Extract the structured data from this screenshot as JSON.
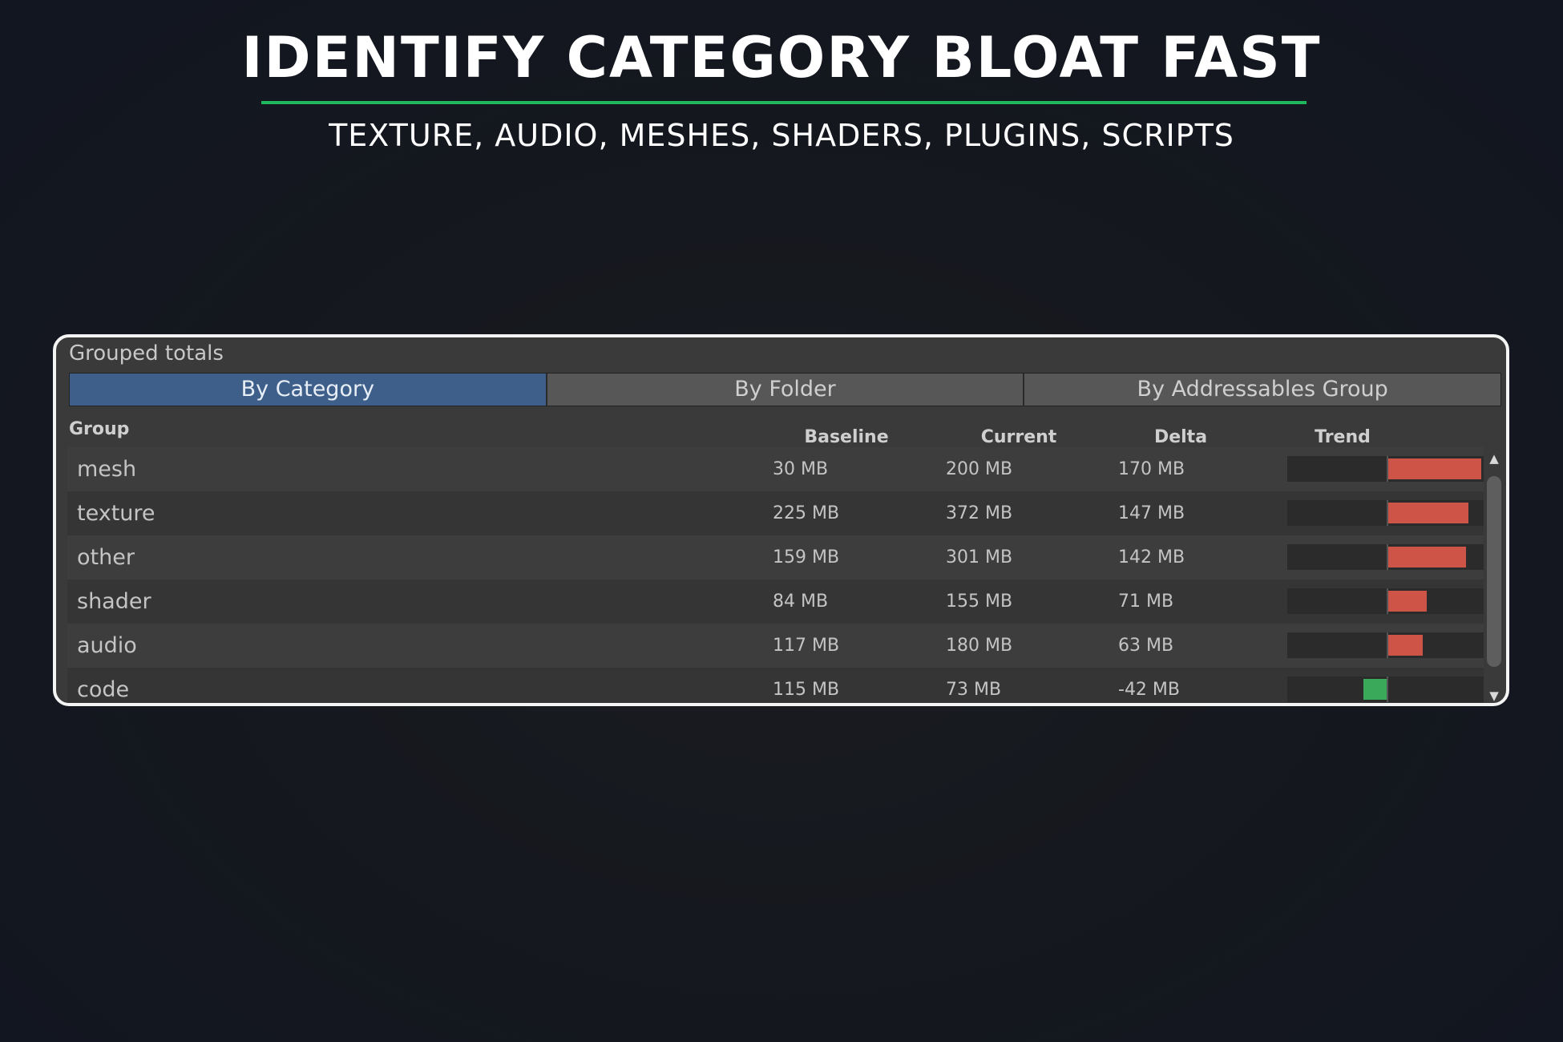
{
  "hero": {
    "title": "IDENTIFY CATEGORY BLOAT FAST",
    "subtitle": "TEXTURE, AUDIO, MESHES, SHADERS, PLUGINS, SCRIPTS"
  },
  "panel": {
    "title": "Grouped totals",
    "tabs": [
      {
        "label": "By Category",
        "active": true
      },
      {
        "label": "By Folder",
        "active": false
      },
      {
        "label": "By Addressables Group",
        "active": false
      }
    ],
    "columns": {
      "group": "Group",
      "baseline": "Baseline",
      "current": "Current",
      "delta": "Delta",
      "trend": "Trend"
    },
    "rows": [
      {
        "group": "mesh",
        "baseline": "30 MB",
        "current": "200 MB",
        "delta": "170 MB",
        "delta_mb": 170
      },
      {
        "group": "texture",
        "baseline": "225 MB",
        "current": "372 MB",
        "delta": "147 MB",
        "delta_mb": 147
      },
      {
        "group": "other",
        "baseline": "159 MB",
        "current": "301 MB",
        "delta": "142 MB",
        "delta_mb": 142
      },
      {
        "group": "shader",
        "baseline": "84 MB",
        "current": "155 MB",
        "delta": "71 MB",
        "delta_mb": 71
      },
      {
        "group": "audio",
        "baseline": "117 MB",
        "current": "180 MB",
        "delta": "63 MB",
        "delta_mb": 63
      },
      {
        "group": "code",
        "baseline": "115 MB",
        "current": "73 MB",
        "delta": "-42 MB",
        "delta_mb": -42
      }
    ],
    "trend_colors": {
      "increase": "#cf5448",
      "decrease": "#3aa95a"
    }
  },
  "colors": {
    "accent_rule": "#1fb85c",
    "active_tab": "#3e5f8a"
  },
  "icons": {
    "scroll_up": "triangle-up-icon",
    "scroll_down": "triangle-down-icon"
  }
}
